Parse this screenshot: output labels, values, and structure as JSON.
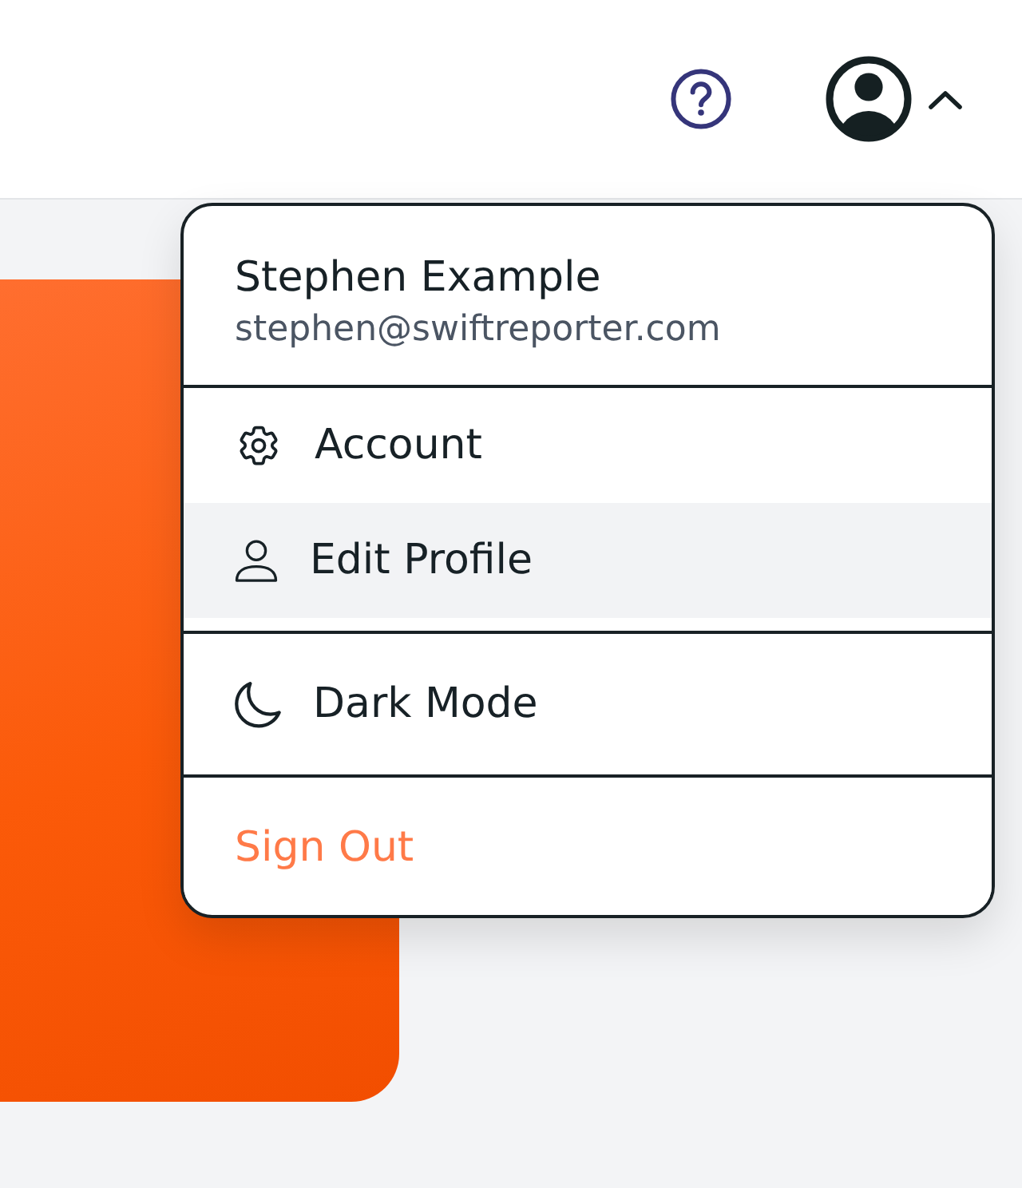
{
  "account_menu": {
    "expanded": true,
    "user": {
      "name": "Stephen Example",
      "email": "stephen@swiftreporter.com"
    },
    "groups": [
      {
        "items": [
          {
            "kind": "account",
            "label": "Account",
            "highlighted": false
          },
          {
            "kind": "profile",
            "label": "Edit Profile",
            "highlighted": true
          }
        ]
      },
      {
        "items": [
          {
            "kind": "theme",
            "label": "Dark Mode",
            "highlighted": false
          }
        ]
      },
      {
        "items": [
          {
            "kind": "signout",
            "label": "Sign Out",
            "highlighted": false
          }
        ]
      }
    ]
  }
}
